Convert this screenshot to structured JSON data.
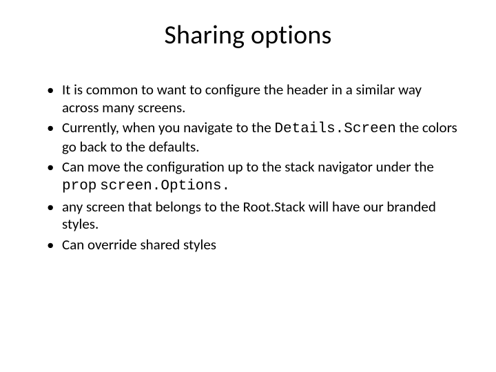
{
  "title": "Sharing options",
  "bullets": {
    "b0": "It is common to want to configure the header in a similar way across many screens.",
    "b1_a": "Currently, when you navigate to the ",
    "b1_code": "Details.Screen",
    "b1_b": " the colors go back to the defaults.",
    "b2_a": "Can move the configuration up to the stack navigator under the ",
    "b2_code1": "prop",
    "b2_mid": " ",
    "b2_code2": "screen.Options.",
    "b3": "any screen that belongs to the Root.Stack will have our branded styles.",
    "b4": "Can override shared styles"
  }
}
